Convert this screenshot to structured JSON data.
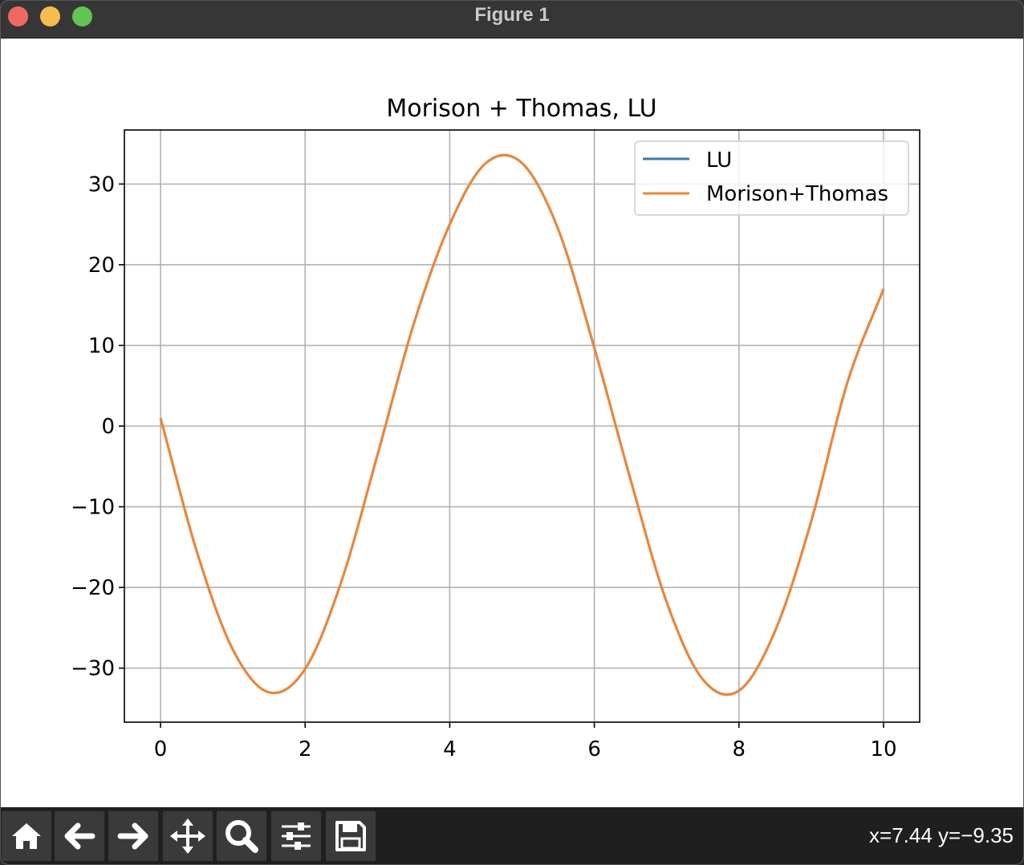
{
  "window": {
    "title": "Figure 1"
  },
  "toolbar": {
    "buttons": [
      {
        "icon": "home-icon"
      },
      {
        "icon": "back-arrow-icon"
      },
      {
        "icon": "forward-arrow-icon"
      },
      {
        "icon": "pan-move-icon"
      },
      {
        "icon": "zoom-magnifier-icon"
      },
      {
        "icon": "subplots-sliders-icon"
      },
      {
        "icon": "save-floppy-icon"
      }
    ],
    "coordinates": "x=7.44 y=−9.35"
  },
  "chart_data": {
    "type": "line",
    "title": "Morison + Thomas, LU",
    "xlabel": "",
    "ylabel": "",
    "xlim": [
      -0.5,
      10.5
    ],
    "ylim": [
      -36.7,
      36.7
    ],
    "xticks": [
      0,
      2,
      4,
      6,
      8,
      10
    ],
    "xtick_labels": [
      "0",
      "2",
      "4",
      "6",
      "8",
      "10"
    ],
    "yticks": [
      30,
      20,
      10,
      0,
      -10,
      -20,
      -30
    ],
    "ytick_labels": [
      "30",
      "20",
      "10",
      "0",
      "−10",
      "−20",
      "−30"
    ],
    "grid": true,
    "legend": "top-right",
    "x": [
      0,
      0.5,
      1,
      1.5,
      2,
      2.5,
      3,
      3.5,
      4,
      4.5,
      5,
      5.5,
      6,
      6.5,
      7,
      7.5,
      8,
      8.5,
      9,
      9.5,
      10
    ],
    "series": [
      {
        "name": "LU",
        "color": "#3b75af",
        "values": [
          1.0,
          -15.5,
          -27.7,
          -33.0,
          -30.1,
          -19.3,
          -3.6,
          12.6,
          25.0,
          32.6,
          32.6,
          24.4,
          9.7,
          -6.6,
          -21.8,
          -31.4,
          -32.8,
          -25.4,
          -11.8,
          5.4,
          17.0
        ]
      },
      {
        "name": "Morison+Thomas",
        "color": "#ef8636",
        "values": [
          1.0,
          -15.5,
          -27.7,
          -33.0,
          -30.1,
          -19.3,
          -3.6,
          12.6,
          25.0,
          32.6,
          32.6,
          24.4,
          9.7,
          -6.6,
          -21.8,
          -31.4,
          -32.8,
          -25.4,
          -11.8,
          5.4,
          17.0
        ]
      }
    ]
  }
}
